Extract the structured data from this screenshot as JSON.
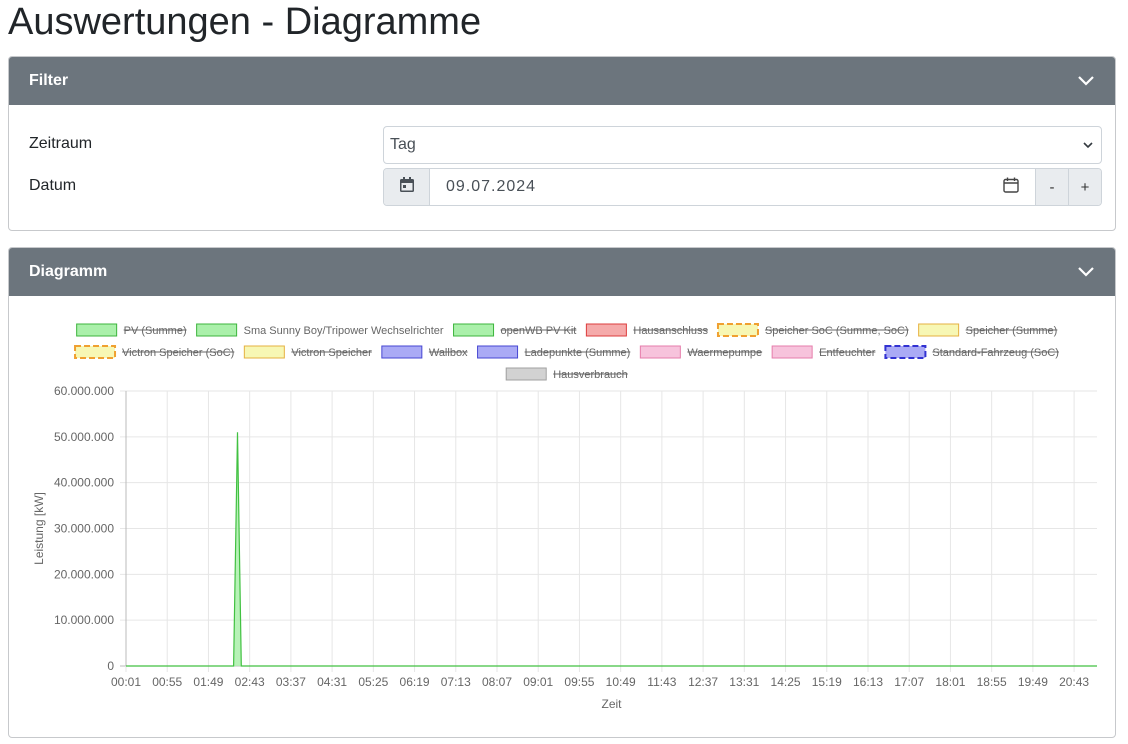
{
  "page": {
    "title": "Auswertungen - Diagramme"
  },
  "filter": {
    "header": "Filter",
    "zeitraum_label": "Zeitraum",
    "zeitraum_value": "Tag",
    "datum_label": "Datum",
    "datum_value": "09.07.2024",
    "minus_label": "-",
    "plus_label": "+"
  },
  "diagram": {
    "header": "Diagramm"
  },
  "colors": {
    "header_bg": "#6c757d",
    "pv_line": "#41c141",
    "pv_fill": "#aaf0aa"
  },
  "chart_data": {
    "type": "area",
    "xlabel": "Zeit",
    "ylabel": "Leistung [kW]",
    "ylim": [
      0,
      60000000
    ],
    "yticks": [
      "60.000.000",
      "50.000.000",
      "40.000.000",
      "30.000.000",
      "20.000.000",
      "10.000.000",
      "0"
    ],
    "x_ticks": [
      "00:01",
      "00:55",
      "01:49",
      "02:43",
      "03:37",
      "04:31",
      "05:25",
      "06:19",
      "07:13",
      "08:07",
      "09:01",
      "09:55",
      "10:49",
      "11:43",
      "12:37",
      "13:31",
      "14:25",
      "15:19",
      "16:13",
      "17:07",
      "18:01",
      "18:55",
      "19:49",
      "20:43"
    ],
    "x_range": [
      "00:01",
      "21:13"
    ],
    "grid": true,
    "legend_position": "top",
    "legend": [
      {
        "name": "PV (Summe)",
        "color": "#aaf0aa",
        "border": "#3cb43c",
        "hidden": true,
        "dashed": false
      },
      {
        "name": "Sma Sunny Boy/Tripower Wechselrichter",
        "color": "#aaf0aa",
        "border": "#3cb43c",
        "hidden": false,
        "dashed": false
      },
      {
        "name": "openWB PV Kit",
        "color": "#aaf0aa",
        "border": "#3cb43c",
        "hidden": true,
        "dashed": false
      },
      {
        "name": "Hausanschluss",
        "color": "#f5aaaa",
        "border": "#dc3c3c",
        "hidden": true,
        "dashed": false
      },
      {
        "name": "Speicher SoC (Summe, SoC)",
        "color": "#f7f7b4",
        "border": "#f0a030",
        "hidden": true,
        "dashed": true
      },
      {
        "name": "Speicher (Summe)",
        "color": "#f7f7b4",
        "border": "#e6b040",
        "hidden": true,
        "dashed": false
      },
      {
        "name": "Victron Speicher (SoC)",
        "color": "#f7f7b4",
        "border": "#f0a030",
        "hidden": true,
        "dashed": true
      },
      {
        "name": "Victron Speicher",
        "color": "#f7f7b4",
        "border": "#e6b040",
        "hidden": true,
        "dashed": false
      },
      {
        "name": "Wallbox",
        "color": "#aaaaf5",
        "border": "#4646d2",
        "hidden": true,
        "dashed": false
      },
      {
        "name": "Ladepunkte (Summe)",
        "color": "#aaaaf5",
        "border": "#4646d2",
        "hidden": true,
        "dashed": false
      },
      {
        "name": "Waermepumpe",
        "color": "#f7c3dc",
        "border": "#e67dab",
        "hidden": true,
        "dashed": false
      },
      {
        "name": "Entfeuchter",
        "color": "#f7c3dc",
        "border": "#e67dab",
        "hidden": true,
        "dashed": false
      },
      {
        "name": "Standard-Fahrzeug (SoC)",
        "color": "#aaaaf5",
        "border": "#3232d2",
        "hidden": true,
        "dashed": true
      },
      {
        "name": "Hausverbrauch",
        "color": "#d2d2d2",
        "border": "#a0a0a0",
        "hidden": true,
        "dashed": false
      }
    ],
    "series": [
      {
        "name": "Sma Sunny Boy/Tripower Wechselrichter",
        "x": [
          "00:01",
          "02:22",
          "02:27",
          "02:32",
          "21:13"
        ],
        "values": [
          0,
          0,
          51000000,
          0,
          0
        ]
      }
    ]
  }
}
